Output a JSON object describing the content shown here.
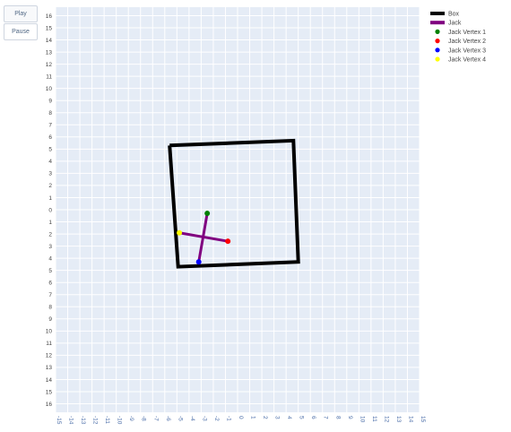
{
  "controls": {
    "play_label": "Play",
    "pause_label": "Pause"
  },
  "chart_data": {
    "type": "scatter",
    "title": "",
    "xlabel": "",
    "ylabel": "",
    "xlim": [
      -15,
      15
    ],
    "ylim": [
      -16.7,
      16.7
    ],
    "x_ticks": [
      -15,
      -14,
      -13,
      -12,
      -11,
      -10,
      -9,
      -8,
      -7,
      -6,
      -5,
      -4,
      -3,
      -2,
      -1,
      0,
      1,
      2,
      3,
      4,
      5,
      6,
      7,
      8,
      9,
      10,
      11,
      12,
      13,
      14,
      15
    ],
    "x_tick_labels": [
      "-15",
      "-14",
      "-13",
      "-12",
      "-11",
      "-10",
      "-9",
      "-8",
      "-7",
      "-6",
      "-5",
      "-4",
      "-3",
      "-2",
      "-1",
      "0",
      "1",
      "2",
      "3",
      "4",
      "5",
      "6",
      "7",
      "8",
      "9",
      "10",
      "11",
      "12",
      "13",
      "14",
      "15"
    ],
    "y_ticks": [
      16,
      15,
      14,
      13,
      12,
      11,
      10,
      9,
      8,
      7,
      6,
      5,
      4,
      3,
      2,
      1,
      0,
      -1,
      -2,
      -3,
      -4,
      -5,
      -6,
      -7,
      -8,
      -9,
      -10,
      -11,
      -12,
      -13,
      -14,
      -15,
      -16
    ],
    "y_tick_labels": [
      "16",
      "15",
      "14",
      "13",
      "12",
      "11",
      "10",
      "9",
      "8",
      "7",
      "6",
      "5",
      "4",
      "3",
      "2",
      "1",
      "0",
      "1",
      "2",
      "3",
      "4",
      "5",
      "6",
      "7",
      "8",
      "9",
      "10",
      "11",
      "12",
      "13",
      "14",
      "15",
      "16"
    ],
    "grid": true,
    "background": "#e5ecf6",
    "legend_position": "top-right",
    "legend": [
      {
        "name": "Box",
        "kind": "line",
        "color": "#000000"
      },
      {
        "name": "Jack",
        "kind": "line",
        "color": "#800080"
      },
      {
        "name": "Jack Vertex 1",
        "kind": "marker",
        "color": "#008000"
      },
      {
        "name": "Jack Vertex 2",
        "kind": "marker",
        "color": "#ff0000"
      },
      {
        "name": "Jack Vertex 3",
        "kind": "marker",
        "color": "#0000ff"
      },
      {
        "name": "Jack Vertex 4",
        "kind": "marker",
        "color": "#ffff00"
      }
    ],
    "box": {
      "name": "Box",
      "color": "#000000",
      "x": [
        -5.6,
        4.6,
        5.0,
        -4.9,
        -5.6
      ],
      "y": [
        5.3,
        5.7,
        -4.3,
        -4.7,
        5.3
      ]
    },
    "jack": {
      "name": "Jack",
      "color": "#800080",
      "segments": [
        {
          "x": [
            -2.5,
            -3.2
          ],
          "y": [
            -0.3,
            -4.3
          ]
        },
        {
          "x": [
            -0.8,
            -4.8
          ],
          "y": [
            -2.6,
            -1.9
          ]
        }
      ]
    },
    "vertices": [
      {
        "name": "Jack Vertex 1",
        "color": "#008000",
        "x": -2.5,
        "y": -0.3
      },
      {
        "name": "Jack Vertex 2",
        "color": "#ff0000",
        "x": -0.8,
        "y": -2.6
      },
      {
        "name": "Jack Vertex 3",
        "color": "#0000ff",
        "x": -3.2,
        "y": -4.3
      },
      {
        "name": "Jack Vertex 4",
        "color": "#ffff00",
        "x": -4.8,
        "y": -1.9
      }
    ]
  }
}
